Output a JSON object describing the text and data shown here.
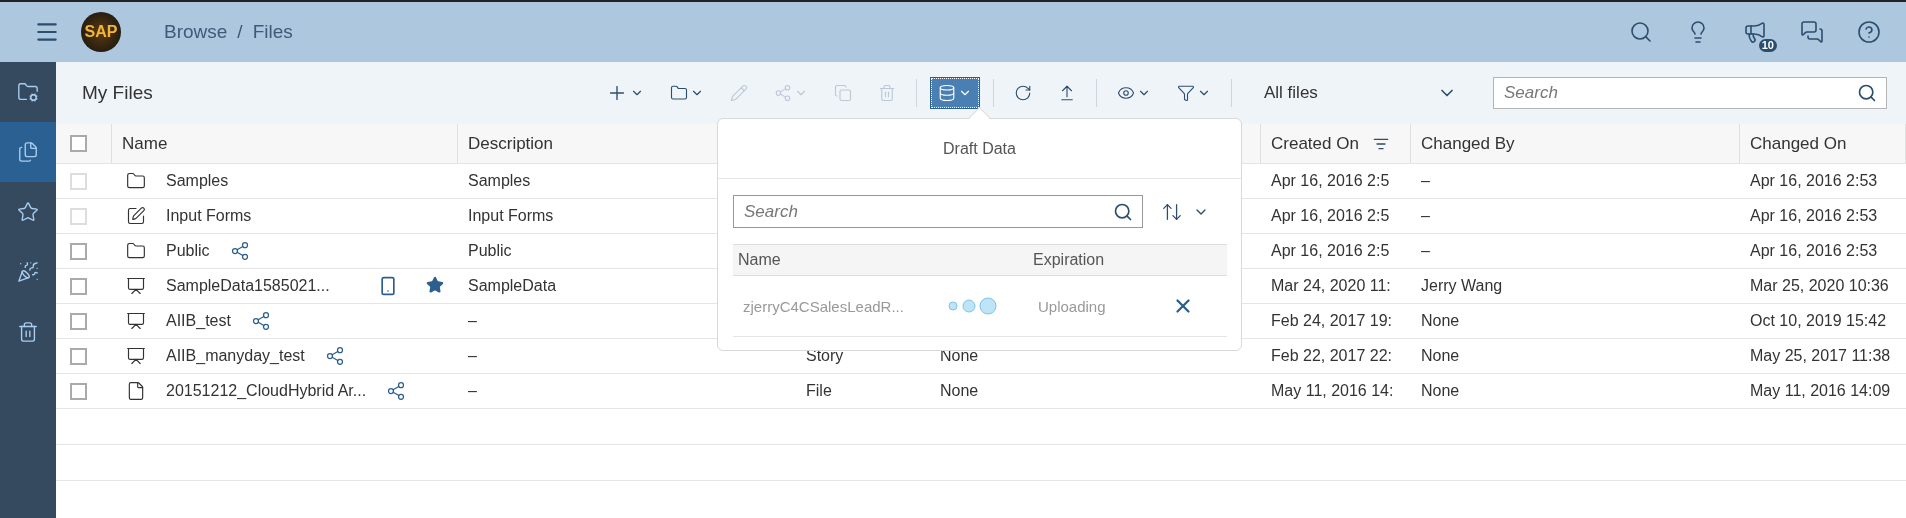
{
  "shell_bar": {
    "logo_text": "SAP",
    "breadcrumb": [
      "Browse",
      "Files"
    ],
    "breadcrumb_separator": "/",
    "actions": [
      {
        "kind": "search"
      },
      {
        "kind": "idea"
      },
      {
        "kind": "announce",
        "badge": "10"
      },
      {
        "kind": "chat"
      },
      {
        "kind": "help"
      }
    ]
  },
  "sidebar": {
    "items": [
      {
        "kind": "folder-settings",
        "selected": false
      },
      {
        "kind": "files",
        "selected": true
      },
      {
        "kind": "star",
        "selected": false
      },
      {
        "kind": "party",
        "selected": false
      },
      {
        "kind": "trash",
        "selected": false
      }
    ]
  },
  "toolbar": {
    "title": "My Files",
    "buttons": [
      {
        "kind": "add",
        "menu": true,
        "disabled": false,
        "selected": false
      },
      {
        "kind": "folder",
        "menu": true,
        "disabled": false,
        "selected": false
      },
      {
        "kind": "edit",
        "menu": false,
        "disabled": true,
        "selected": false
      },
      {
        "kind": "share",
        "menu": true,
        "disabled": true,
        "selected": false
      },
      {
        "kind": "copy",
        "menu": false,
        "disabled": true,
        "selected": false
      },
      {
        "kind": "delete",
        "menu": false,
        "disabled": true,
        "selected": false
      },
      {
        "kind": "database",
        "menu": true,
        "disabled": false,
        "selected": true
      },
      {
        "kind": "refresh",
        "menu": false,
        "disabled": false,
        "selected": false
      },
      {
        "kind": "upload",
        "menu": false,
        "disabled": false,
        "selected": false
      },
      {
        "kind": "view",
        "menu": true,
        "disabled": false,
        "selected": false
      },
      {
        "kind": "filter",
        "menu": true,
        "disabled": false,
        "selected": false
      }
    ],
    "filter_select": "All files",
    "search": {
      "placeholder": "Search"
    }
  },
  "table": {
    "select_all": {
      "checked": false
    },
    "columns": [
      {
        "label": "Name",
        "sorted": false
      },
      {
        "label": "Description",
        "sorted": false
      },
      {
        "label": "Created On",
        "sorted": true
      },
      {
        "label": "Changed By",
        "sorted": false
      },
      {
        "label": "Changed On",
        "sorted": false
      }
    ],
    "rows": [
      {
        "kind": "folder",
        "name": "Samples",
        "shared": false,
        "mobile": false,
        "favorite": false,
        "disabled": true,
        "selected": false,
        "description": "Samples",
        "created_on": "Apr 16, 2016 2:5",
        "changed_by": "–",
        "changed_on": "Apr 16, 2016 2:53"
      },
      {
        "kind": "form",
        "name": "Input Forms",
        "shared": false,
        "mobile": false,
        "favorite": false,
        "disabled": true,
        "selected": false,
        "description": "Input Forms",
        "created_on": "Apr 16, 2016 2:5",
        "changed_by": "–",
        "changed_on": "Apr 16, 2016 2:53"
      },
      {
        "kind": "folder",
        "name": "Public",
        "shared": true,
        "mobile": false,
        "favorite": false,
        "disabled": false,
        "selected": false,
        "description": "Public",
        "created_on": "Apr 16, 2016 2:5",
        "changed_by": "–",
        "changed_on": "Apr 16, 2016 2:53"
      },
      {
        "kind": "story",
        "name": "SampleData1585021...",
        "shared": false,
        "mobile": true,
        "favorite": true,
        "disabled": false,
        "selected": false,
        "description": "SampleData",
        "created_on": "Mar 24, 2020 11:",
        "changed_by": "Jerry Wang",
        "changed_on": "Mar 25, 2020 10:36"
      },
      {
        "kind": "story",
        "name": "AIIB_test",
        "shared": true,
        "mobile": false,
        "favorite": false,
        "disabled": false,
        "selected": false,
        "description": "–",
        "created_on": "Feb 24, 2017 19:",
        "changed_by": "None",
        "changed_on": "Oct 10, 2019 15:42"
      },
      {
        "kind": "story",
        "name": "AIIB_manyday_test",
        "shared": true,
        "mobile": false,
        "favorite": false,
        "disabled": false,
        "selected": false,
        "description": "–",
        "column_3": "Story",
        "column_4": "None",
        "created_on": "Feb 22, 2017 22:",
        "changed_by": "None",
        "changed_on": "May 25, 2017 11:38"
      },
      {
        "kind": "file",
        "name": "20151212_CloudHybrid Ar...",
        "shared": true,
        "mobile": false,
        "favorite": false,
        "disabled": false,
        "selected": false,
        "description": "–",
        "column_3": "File",
        "column_4": "None",
        "created_on": "May 11, 2016 14:",
        "changed_by": "None",
        "changed_on": "May 11, 2016 14:09"
      }
    ]
  },
  "draft_popover": {
    "title": "Draft Data",
    "search": {
      "placeholder": "Search"
    },
    "columns": [
      "Name",
      "Expiration"
    ],
    "rows": [
      {
        "name": "zjerryC4CSalesLeadR...",
        "status": "Uploading",
        "loading": true
      }
    ]
  }
}
